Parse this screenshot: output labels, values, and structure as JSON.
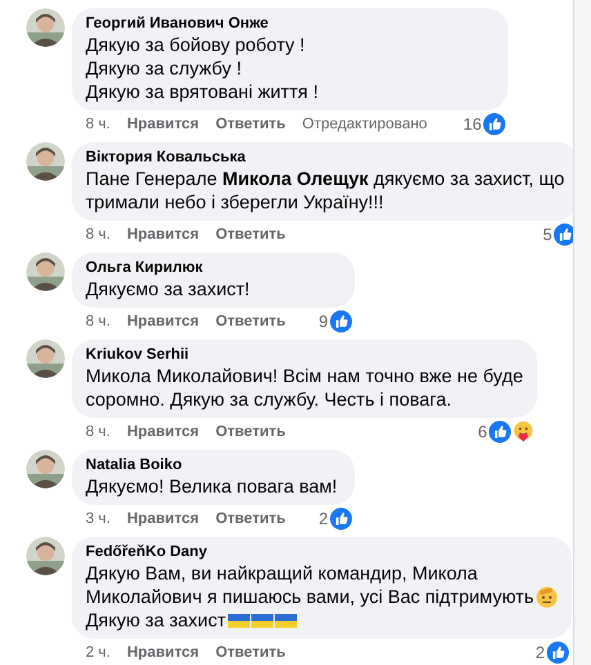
{
  "comments": [
    {
      "author": "Георгий Иванович Онже",
      "avatar": {
        "kind": "picture"
      },
      "lines": [
        {
          "text": "Дякую за бойову роботу !"
        },
        {
          "text": "Дякую за службу !"
        },
        {
          "text": "Дякую за врятовані життя !"
        }
      ],
      "time": "8 ч.",
      "like": "Нравится",
      "reply": "Ответить",
      "edited": "Отредактировано",
      "count": "16",
      "reactions": [
        {
          "kind": "like"
        }
      ]
    },
    {
      "author": "Віктория Ковальська",
      "avatar": {
        "kind": "picture"
      },
      "lines": [
        {
          "text": "Пане Генерале **Микола Олещук** дякуємо за захист, що"
        },
        {
          "text": "тримали небо і зберегли Україну!!!"
        }
      ],
      "time": "8 ч.",
      "like": "Нравится",
      "reply": "Ответить",
      "count": "5",
      "reactions": [
        {
          "kind": "like"
        }
      ]
    },
    {
      "author": "Ольга Кирилюк",
      "avatar": {
        "kind": "picture"
      },
      "lines": [
        {
          "text": "Дякуємо за захист!"
        }
      ],
      "time": "8 ч.",
      "like": "Нравится",
      "reply": "Ответить",
      "count": "9",
      "reactions": [
        {
          "kind": "like"
        }
      ]
    },
    {
      "author": "Kriukov Serhii",
      "avatar": {
        "kind": "picture"
      },
      "lines": [
        {
          "text": "Микола Миколайович! Всім нам точно вже не буде"
        },
        {
          "text": "соромно. Дякую за службу. Честь і повага."
        }
      ],
      "time": "8 ч.",
      "like": "Нравится",
      "reply": "Ответить",
      "count": "6",
      "reactions": [
        {
          "kind": "like"
        },
        {
          "kind": "care"
        }
      ]
    },
    {
      "author": "Natalia Boiko",
      "avatar": {
        "kind": "picture"
      },
      "lines": [
        {
          "text": "Дякуємо! Велика повага вам!"
        }
      ],
      "time": "3 ч.",
      "like": "Нравится",
      "reply": "Ответить",
      "count": "2",
      "reactions": [
        {
          "kind": "like"
        }
      ]
    },
    {
      "author": "FedőřeňKo Dany",
      "avatar": {
        "kind": "picture"
      },
      "lines": [
        {
          "text": "Дякую Вам, ви найкращий командир, Микола"
        },
        {
          "text": "Миколайович я пишаюсь вами, усі Вас підтримують",
          "emoji": [
            {
              "kind": "salute"
            }
          ]
        },
        {
          "text": "Дякую за захист",
          "emoji": [
            {
              "kind": "flag"
            },
            {
              "kind": "flag"
            },
            {
              "kind": "flag"
            }
          ]
        }
      ],
      "time": "2 ч.",
      "like": "Нравится",
      "reply": "Ответить",
      "count": "2",
      "reactions": [
        {
          "kind": "like"
        }
      ]
    }
  ]
}
